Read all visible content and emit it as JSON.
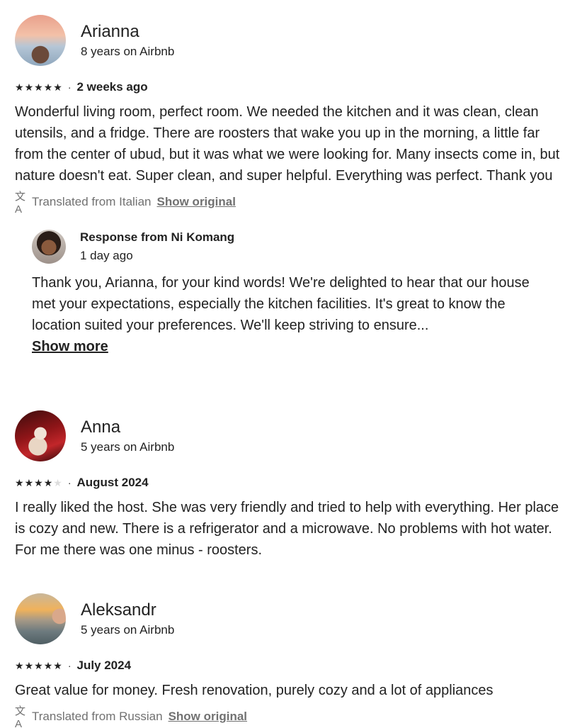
{
  "reviews": [
    {
      "name": "Arianna",
      "tenure": "8 years on Airbnb",
      "rating": 5,
      "date": "2 weeks ago",
      "text": "Wonderful living room, perfect room. We needed the kitchen and it was clean, clean utensils, and a fridge. There are roosters that wake you up in the morning, a little far from the center of ubud, but it was what we were looking for. Many insects come in, but nature doesn't eat. Super clean, and super helpful. Everything was perfect. Thank you",
      "translated_label": "Translated from Italian",
      "show_original": "Show original",
      "response": {
        "from": "Response from Ni Komang",
        "date": "1 day ago",
        "text": "Thank you, Arianna, for your kind words! We're delighted to hear that our house met your expectations, especially the kitchen facilities. It's great to know the location suited your preferences. We'll keep striving to ensure...",
        "show_more": "Show more"
      }
    },
    {
      "name": "Anna",
      "tenure": "5 years on Airbnb",
      "rating": 4,
      "date": "August 2024",
      "text": "I really liked the host. She was very friendly and tried to help with everything. Her place is cozy and new. There is a refrigerator and a microwave. No problems with hot water. For me there was one minus - roosters."
    },
    {
      "name": "Aleksandr",
      "tenure": "5 years on Airbnb",
      "rating": 5,
      "date": "July 2024",
      "text": "Great value for money. Fresh renovation, purely cozy and a lot of appliances",
      "translated_label": "Translated from Russian",
      "show_original": "Show original"
    }
  ],
  "glyphs": {
    "star": "★",
    "separator": "·",
    "translate_icon": "文A"
  },
  "colors": {
    "text": "#222222",
    "muted": "#717171",
    "star_off": "#dddddd"
  }
}
